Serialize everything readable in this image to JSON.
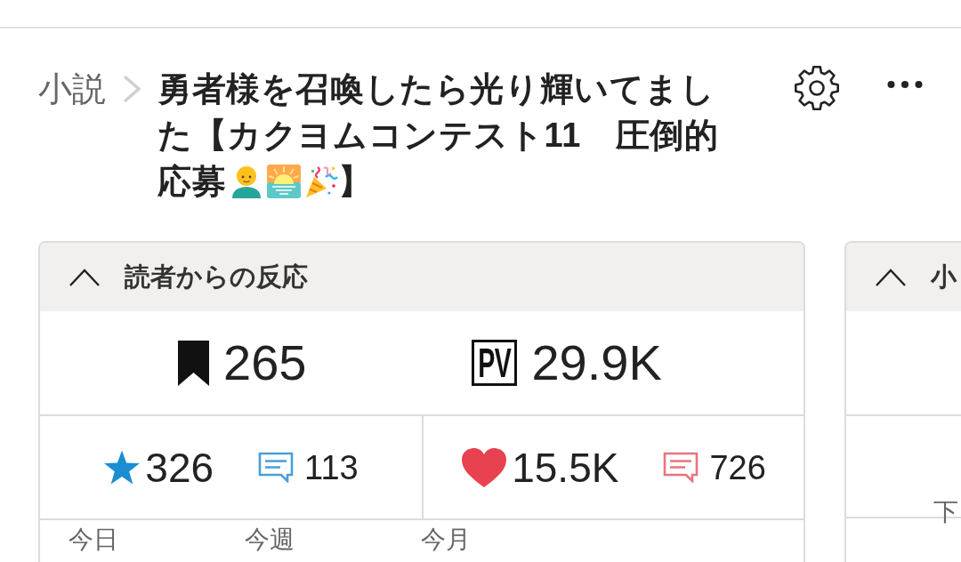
{
  "breadcrumb": {
    "category": "小説",
    "title_lines": [
      "勇者様を召喚したら光り輝いてまし",
      "た【カクヨムコンテスト11　圧倒的",
      "応募"
    ],
    "title_end": "】"
  },
  "panels": [
    {
      "title": "読者からの反応",
      "expanded": true,
      "totals": [
        {
          "kind": "bookmarks",
          "value": "265"
        },
        {
          "kind": "page_views",
          "label": "PV",
          "value": "29.9K"
        }
      ],
      "reactions": [
        {
          "kind": "stars",
          "count": "326",
          "comments": "113"
        },
        {
          "kind": "hearts",
          "count": "15.5K",
          "comments": "726"
        }
      ],
      "periods": [
        "今日",
        "今週",
        "今月"
      ]
    },
    {
      "title": "小",
      "expanded": true,
      "note": "下"
    }
  ]
}
